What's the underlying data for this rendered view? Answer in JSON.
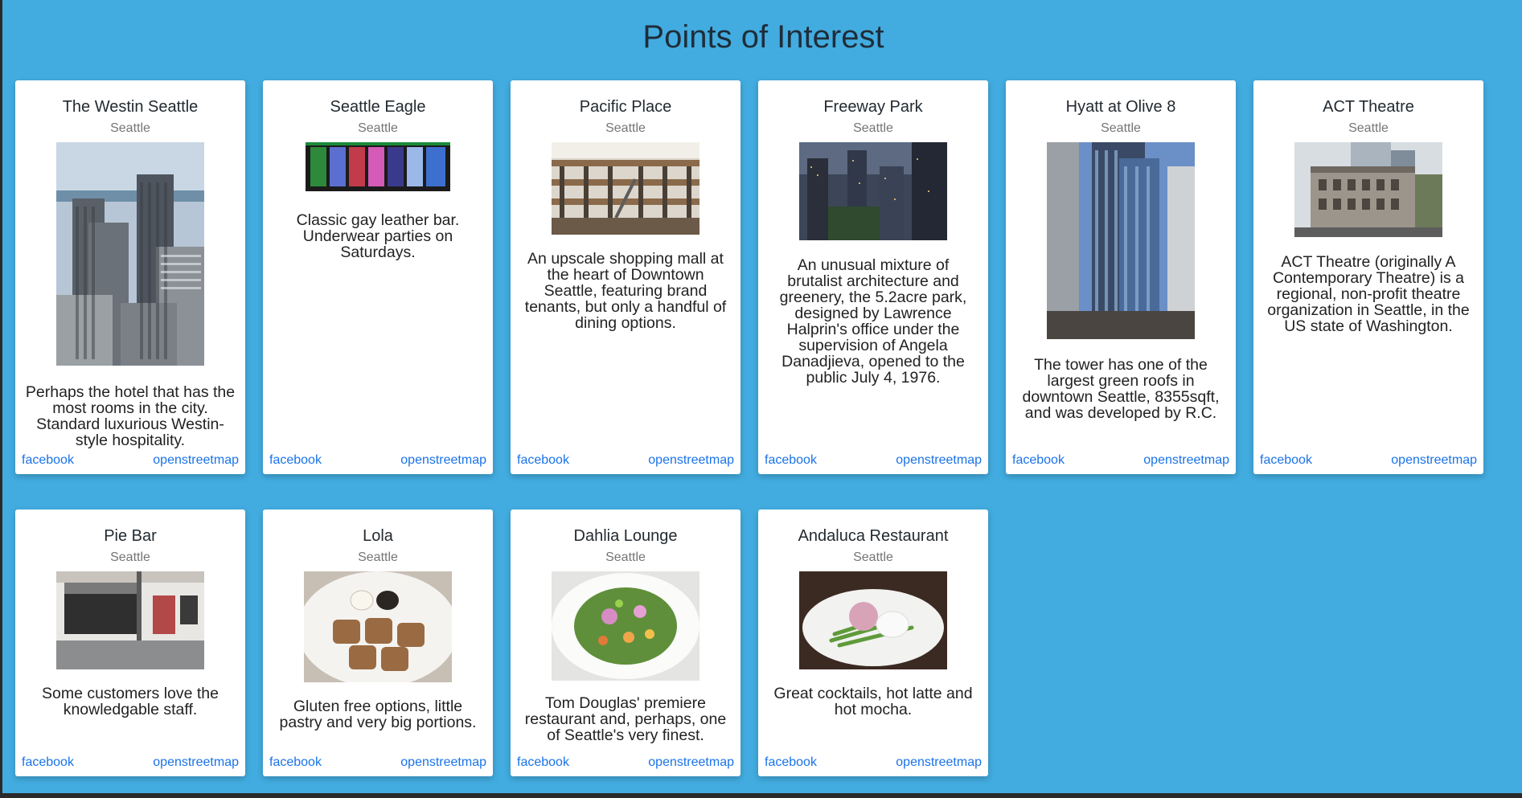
{
  "page": {
    "title": "Points of Interest"
  },
  "cards": [
    {
      "name": "The Westin Seattle",
      "city": "Seattle",
      "description": "Perhaps the hotel that has the most rooms in the city. Standard luxurious Westin-style hospitality.",
      "image_alt": "twin tower hotel",
      "facebook": "facebook",
      "map": "openstreetmap"
    },
    {
      "name": "Seattle Eagle",
      "city": "Seattle",
      "description": "Classic gay leather bar. Underwear parties on Saturdays.",
      "image_alt": "poster row",
      "facebook": "facebook",
      "map": "openstreetmap"
    },
    {
      "name": "Pacific Place",
      "city": "Seattle",
      "description": "An upscale shopping mall at the heart of Downtown Seattle, featuring brand tenants, but only a handful of dining options.",
      "image_alt": "mall atrium",
      "facebook": "facebook",
      "map": "openstreetmap"
    },
    {
      "name": "Freeway Park",
      "city": "Seattle",
      "description": "An unusual mixture of brutalist architecture and greenery, the 5.2acre park, designed by Lawrence Halprin's office under the supervision of Angela Danadjieva, opened to the public July 4, 1976.",
      "image_alt": "city at dusk",
      "facebook": "facebook",
      "map": "openstreetmap"
    },
    {
      "name": "Hyatt at Olive 8",
      "city": "Seattle",
      "description": "The tower has one of the largest green roofs in downtown Seattle, 8355sqft, and was developed by R.C.",
      "image_alt": "glass tower",
      "facebook": "facebook",
      "map": "openstreetmap"
    },
    {
      "name": "ACT Theatre",
      "city": "Seattle",
      "description": "ACT Theatre (originally A Contemporary Theatre) is a regional, non-profit theatre organization in Seattle, in the US state of Washington.",
      "image_alt": "theatre building",
      "facebook": "facebook",
      "map": "openstreetmap"
    },
    {
      "name": "Pie Bar",
      "city": "Seattle",
      "description": "Some customers love the knowledgable staff.",
      "image_alt": "storefront",
      "facebook": "facebook",
      "map": "openstreetmap"
    },
    {
      "name": "Lola",
      "city": "Seattle",
      "description": "Gluten free options, little pastry and very big portions.",
      "image_alt": "doughnuts on plate",
      "facebook": "facebook",
      "map": "openstreetmap"
    },
    {
      "name": "Dahlia Lounge",
      "city": "Seattle",
      "description": "Tom Douglas' premiere restaurant and, perhaps, one of Seattle's very finest.",
      "image_alt": "salad plate",
      "facebook": "facebook",
      "map": "openstreetmap"
    },
    {
      "name": "Andaluca Restaurant",
      "city": "Seattle",
      "description": "Great cocktails, hot latte and hot mocha.",
      "image_alt": "plated dish",
      "facebook": "facebook",
      "map": "openstreetmap"
    }
  ],
  "colors": {
    "background": "#42ace0",
    "card": "#ffffff",
    "link": "#1a73e8",
    "city_text": "#757575"
  }
}
